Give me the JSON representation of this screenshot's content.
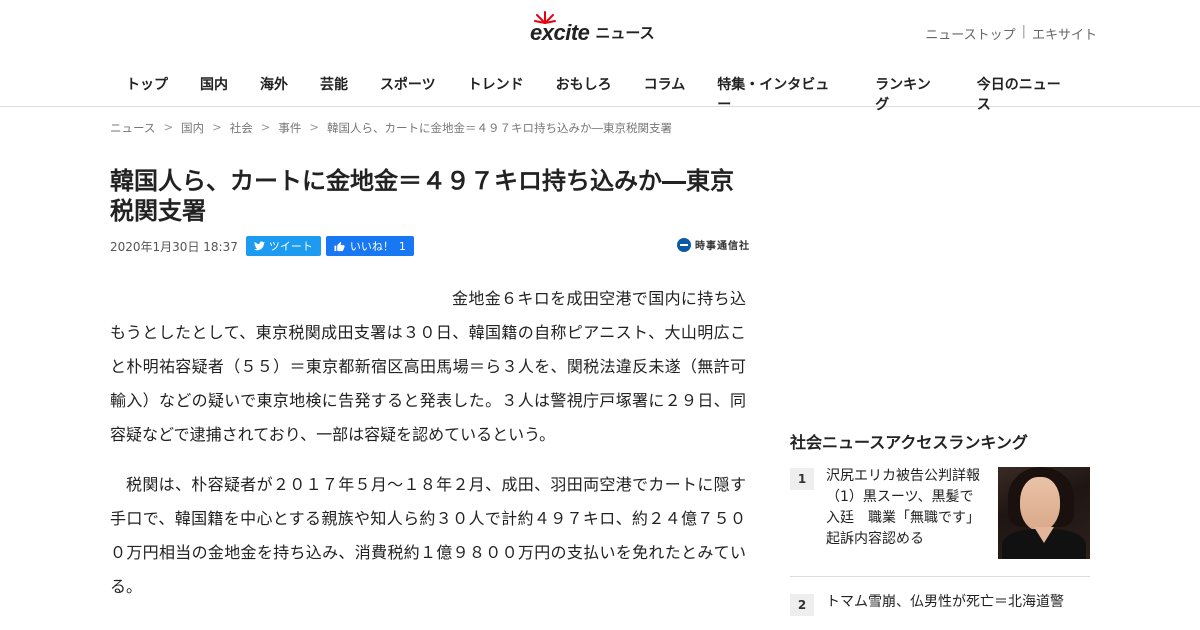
{
  "header": {
    "logo_text": "excite",
    "logo_suffix": "ニュース",
    "top_links": [
      "ニューストップ",
      "エキサイト"
    ],
    "nav": [
      "トップ",
      "国内",
      "海外",
      "芸能",
      "スポーツ",
      "トレンド",
      "おもしろ",
      "コラム",
      "特集・インタビュー",
      "ランキング",
      "今日のニュース"
    ]
  },
  "breadcrumb": [
    "ニュース",
    "国内",
    "社会",
    "事件",
    "韓国人ら、カートに金地金＝４９７キロ持ち込みか―東京税関支署"
  ],
  "article": {
    "title": "韓国人ら、カートに金地金＝４９７キロ持ち込みか―東京税関支署",
    "date": "2020年1月30日 18:37",
    "tweet_label": "ツイート",
    "like_label": "いいね！",
    "like_count": "1",
    "source": "時事通信社",
    "paragraphs": [
      "金地金６キロを成田空港で国内に持ち込もうとしたとして、東京税関成田支署は３０日、韓国籍の自称ピアニスト、大山明広こと朴明祐容疑者（５５）＝東京都新宿区高田馬場＝ら３人を、関税法違反未遂（無許可輸入）などの疑いで東京地検に告発すると発表した。３人は警視庁戸塚署に２９日、同容疑などで逮捕されており、一部は容疑を認めているという。",
      "税関は、朴容疑者が２０１７年５月〜１８年２月、成田、羽田両空港でカートに隠す手口で、韓国籍を中心とする親族や知人ら約３０人で計約４９７キロ、約２４億７５００万円相当の金地金を持ち込み、消費税約１億９８００万円の支払いを免れたとみている。"
    ]
  },
  "sidebar": {
    "ranking_title": "社会ニュースアクセスランキング",
    "items": [
      {
        "rank": "1",
        "title": "沢尻エリカ被告公判詳報（1）黒スーツ、黒髪で入廷　職業「無職です」　起訴内容認める"
      },
      {
        "rank": "2",
        "title": "トマム雪崩、仏男性が死亡＝北海道警"
      }
    ]
  }
}
